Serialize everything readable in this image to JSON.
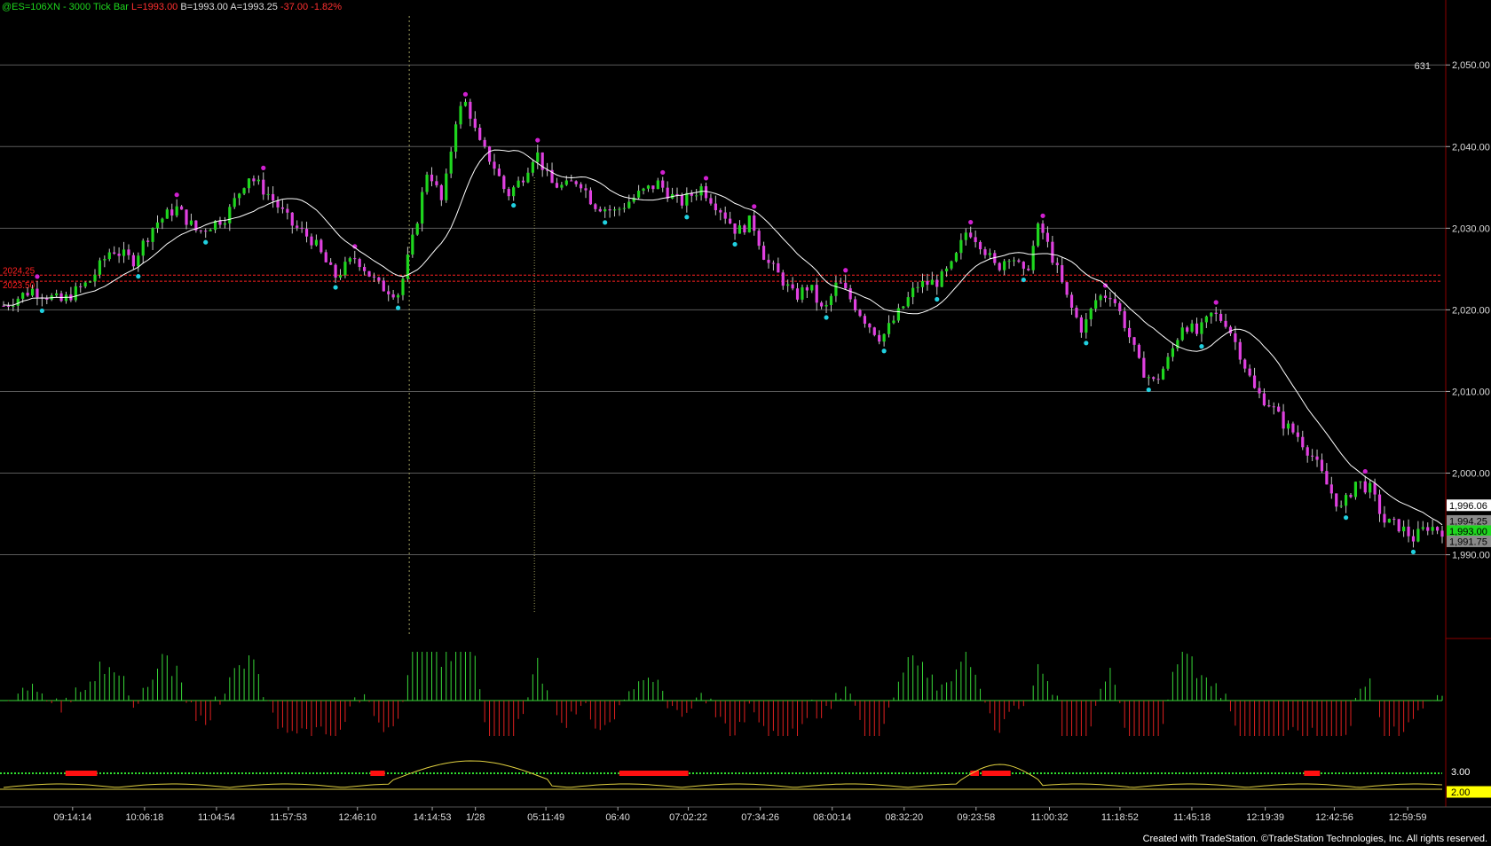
{
  "header": {
    "symbol": "@ES=106XN - 3000 Tick Bar",
    "low": "L=1993.00",
    "bid": "B=1993.00",
    "ask": "A=1993.25",
    "change": "-37.00",
    "change_pct": "-1.82%"
  },
  "footer": "Created with TradeStation. ©TradeStation Technologies, Inc. All rights reserved.",
  "colors": {
    "up_bar": "#1ed61e",
    "down_bar": "#e040e0",
    "swing_high_dot": "#d020d0",
    "swing_low_dot": "#20d0e0",
    "average_line": "#ffffff",
    "level_line": "#ff2020",
    "osc_positive": "#38d838",
    "osc_negative": "#e02020",
    "lower_line": "#e0d040",
    "axis_line": "#8b0000"
  },
  "chart_data": {
    "type": "candlestick",
    "y_axis": {
      "range": [
        1983,
        2056
      ],
      "ticks": [
        1990,
        2000,
        2010,
        2020,
        2030,
        2040,
        2050
      ],
      "tick_labels": [
        "1,990.00",
        "2,000.00",
        "2,010.00",
        "2,020.00",
        "2,030.00",
        "2,040.00",
        "2,050.00"
      ]
    },
    "x_axis": {
      "tick_labels": [
        "09:14:14",
        "10:06:18",
        "11:04:54",
        "11:57:53",
        "12:46:10",
        "14:14:53",
        "1/28",
        "05:11:49",
        "06:40",
        "07:02:22",
        "07:34:26",
        "08:00:14",
        "08:32:20",
        "09:23:58",
        "11:00:32",
        "11:18:52",
        "11:45:18",
        "12:19:39",
        "12:42:56",
        "12:59:59"
      ],
      "tick_fractions": [
        0.048,
        0.098,
        0.148,
        0.198,
        0.246,
        0.298,
        0.328,
        0.377,
        0.427,
        0.476,
        0.526,
        0.576,
        0.626,
        0.676,
        0.727,
        0.776,
        0.826,
        0.877,
        0.925,
        0.976
      ]
    },
    "volume_label": "631",
    "price_path": [
      [
        0.0,
        2020.5
      ],
      [
        0.02,
        2022.5
      ],
      [
        0.04,
        2021.0
      ],
      [
        0.06,
        2023.5
      ],
      [
        0.075,
        2027.5
      ],
      [
        0.09,
        2026.0
      ],
      [
        0.105,
        2030.5
      ],
      [
        0.12,
        2032.5
      ],
      [
        0.135,
        2029.5
      ],
      [
        0.155,
        2031.5
      ],
      [
        0.17,
        2036.5
      ],
      [
        0.185,
        2034.0
      ],
      [
        0.2,
        2030.5
      ],
      [
        0.215,
        2028.5
      ],
      [
        0.23,
        2024.0
      ],
      [
        0.245,
        2026.5
      ],
      [
        0.26,
        2023.0
      ],
      [
        0.275,
        2022.0
      ],
      [
        0.285,
        2029.0
      ],
      [
        0.295,
        2037.5
      ],
      [
        0.305,
        2033.0
      ],
      [
        0.315,
        2044.0
      ],
      [
        0.322,
        2045.5
      ],
      [
        0.33,
        2040.5
      ],
      [
        0.34,
        2038.0
      ],
      [
        0.35,
        2034.0
      ],
      [
        0.36,
        2036.0
      ],
      [
        0.37,
        2039.5
      ],
      [
        0.38,
        2035.5
      ],
      [
        0.39,
        2035.0
      ],
      [
        0.4,
        2036.0
      ],
      [
        0.41,
        2033.0
      ],
      [
        0.425,
        2032.0
      ],
      [
        0.44,
        2034.0
      ],
      [
        0.455,
        2035.5
      ],
      [
        0.47,
        2033.0
      ],
      [
        0.485,
        2035.0
      ],
      [
        0.5,
        2032.0
      ],
      [
        0.51,
        2029.5
      ],
      [
        0.52,
        2031.0
      ],
      [
        0.53,
        2026.0
      ],
      [
        0.54,
        2024.0
      ],
      [
        0.55,
        2021.5
      ],
      [
        0.56,
        2023.0
      ],
      [
        0.57,
        2019.5
      ],
      [
        0.58,
        2023.5
      ],
      [
        0.59,
        2021.0
      ],
      [
        0.6,
        2018.5
      ],
      [
        0.61,
        2016.5
      ],
      [
        0.62,
        2019.0
      ],
      [
        0.635,
        2023.0
      ],
      [
        0.65,
        2023.5
      ],
      [
        0.66,
        2025.5
      ],
      [
        0.67,
        2030.0
      ],
      [
        0.68,
        2028.0
      ],
      [
        0.69,
        2025.0
      ],
      [
        0.7,
        2027.0
      ],
      [
        0.71,
        2024.0
      ],
      [
        0.72,
        2030.5
      ],
      [
        0.73,
        2026.0
      ],
      [
        0.74,
        2021.0
      ],
      [
        0.75,
        2017.5
      ],
      [
        0.76,
        2021.5
      ],
      [
        0.77,
        2022.0
      ],
      [
        0.78,
        2018.0
      ],
      [
        0.79,
        2013.0
      ],
      [
        0.8,
        2011.0
      ],
      [
        0.81,
        2014.0
      ],
      [
        0.82,
        2018.5
      ],
      [
        0.83,
        2017.0
      ],
      [
        0.84,
        2019.5
      ],
      [
        0.85,
        2018.5
      ],
      [
        0.86,
        2014.5
      ],
      [
        0.87,
        2010.0
      ],
      [
        0.88,
        2008.5
      ],
      [
        0.89,
        2006.0
      ],
      [
        0.9,
        2004.5
      ],
      [
        0.91,
        2002.0
      ],
      [
        0.92,
        1998.5
      ],
      [
        0.93,
        1995.5
      ],
      [
        0.94,
        1999.0
      ],
      [
        0.95,
        1998.0
      ],
      [
        0.96,
        1994.0
      ],
      [
        0.97,
        1993.5
      ],
      [
        0.98,
        1992.0
      ],
      [
        0.99,
        1993.5
      ],
      [
        1.0,
        1993.0
      ]
    ],
    "level_labels": [
      {
        "value": 2024.25,
        "label": "2024.25"
      },
      {
        "value": 2023.5,
        "label": "2023.50"
      }
    ],
    "right_tags": [
      {
        "value": 1996.06,
        "label": "1,996.06",
        "bg": "#ffffff",
        "fg": "#000000"
      },
      {
        "value": 1994.25,
        "label": "1,994.25",
        "bg": "#8a8a8a",
        "fg": "#000000"
      },
      {
        "value": 1993.0,
        "label": "1,993.00",
        "bg": "#1ed61e",
        "fg": "#000000"
      },
      {
        "value": 1991.75,
        "label": "1,991.75",
        "bg": "#8a8a8a",
        "fg": "#000000"
      }
    ],
    "lower_panel": {
      "tags": [
        {
          "label": "3.00",
          "bg": "#000000",
          "fg": "#ffffff"
        },
        {
          "label": "2.00",
          "bg": "#ffff00",
          "fg": "#000000"
        }
      ]
    }
  }
}
